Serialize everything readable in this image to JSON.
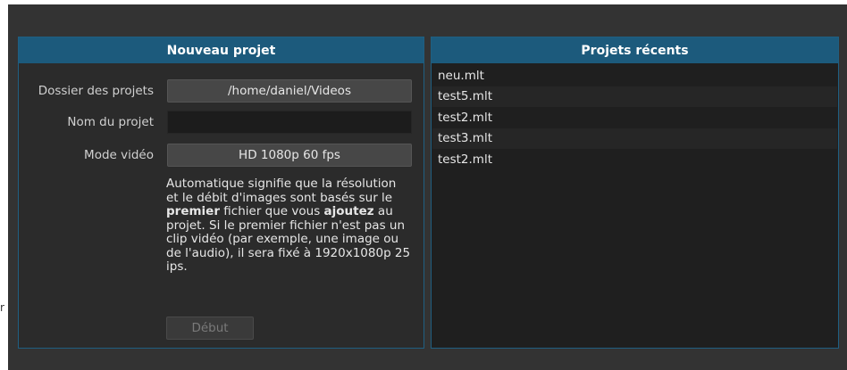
{
  "left_panel": {
    "title": "Nouveau projet",
    "folder_label": "Dossier des projets",
    "folder_value": "/home/daniel/Videos",
    "name_label": "Nom du projet",
    "name_value": "",
    "mode_label": "Mode vidéo",
    "mode_value": "HD 1080p 60 fps",
    "info_part1": "Automatique signifie que la résolution et le débit d'images sont basés sur le ",
    "info_bold1": "premier",
    "info_part2": " fichier que vous ",
    "info_bold2": "ajoutez",
    "info_part3": " au projet. Si le premier fichier n'est pas un clip vidéo (par exemple, une image ou de l'audio), il sera fixé à 1920x1080p 25 ips.",
    "start_label": "Début"
  },
  "right_panel": {
    "title": "Projets récents",
    "items": [
      {
        "label": "neu.mlt"
      },
      {
        "label": "test5.mlt"
      },
      {
        "label": "test2.mlt"
      },
      {
        "label": "test3.mlt"
      },
      {
        "label": "test2.mlt"
      }
    ]
  },
  "colors": {
    "header_bg": "#1c5a7c",
    "panel_border": "#1f5f82",
    "window_bg": "#333333"
  }
}
